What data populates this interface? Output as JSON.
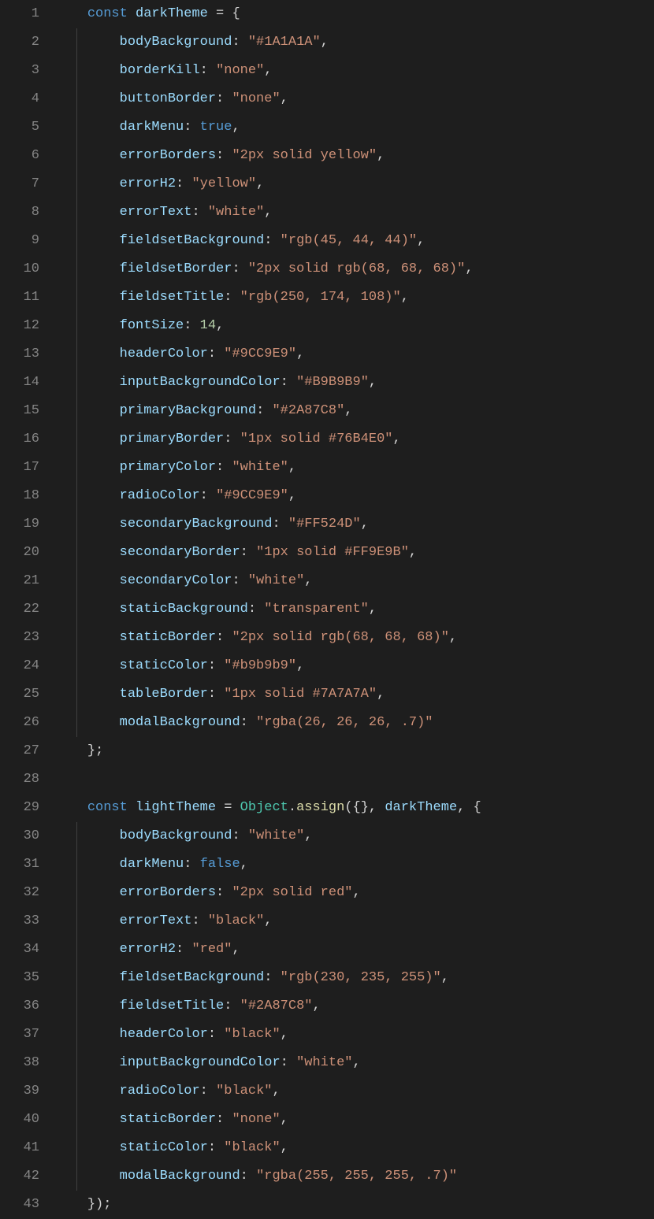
{
  "lines": [
    {
      "n": 1,
      "indent": 1,
      "guides": 0,
      "tokens": [
        [
          "kw",
          "const"
        ],
        [
          "pun",
          " "
        ],
        [
          "var",
          "darkTheme"
        ],
        [
          "pun",
          " = {"
        ]
      ]
    },
    {
      "n": 2,
      "indent": 2,
      "guides": 1,
      "tokens": [
        [
          "prop",
          "bodyBackground"
        ],
        [
          "pun",
          ": "
        ],
        [
          "str",
          "\"#1A1A1A\""
        ],
        [
          "pun",
          ","
        ]
      ]
    },
    {
      "n": 3,
      "indent": 2,
      "guides": 1,
      "tokens": [
        [
          "prop",
          "borderKill"
        ],
        [
          "pun",
          ": "
        ],
        [
          "str",
          "\"none\""
        ],
        [
          "pun",
          ","
        ]
      ]
    },
    {
      "n": 4,
      "indent": 2,
      "guides": 1,
      "tokens": [
        [
          "prop",
          "buttonBorder"
        ],
        [
          "pun",
          ": "
        ],
        [
          "str",
          "\"none\""
        ],
        [
          "pun",
          ","
        ]
      ]
    },
    {
      "n": 5,
      "indent": 2,
      "guides": 1,
      "tokens": [
        [
          "prop",
          "darkMenu"
        ],
        [
          "pun",
          ": "
        ],
        [
          "bool",
          "true"
        ],
        [
          "pun",
          ","
        ]
      ]
    },
    {
      "n": 6,
      "indent": 2,
      "guides": 1,
      "tokens": [
        [
          "prop",
          "errorBorders"
        ],
        [
          "pun",
          ": "
        ],
        [
          "str",
          "\"2px solid yellow\""
        ],
        [
          "pun",
          ","
        ]
      ]
    },
    {
      "n": 7,
      "indent": 2,
      "guides": 1,
      "tokens": [
        [
          "prop",
          "errorH2"
        ],
        [
          "pun",
          ": "
        ],
        [
          "str",
          "\"yellow\""
        ],
        [
          "pun",
          ","
        ]
      ]
    },
    {
      "n": 8,
      "indent": 2,
      "guides": 1,
      "tokens": [
        [
          "prop",
          "errorText"
        ],
        [
          "pun",
          ": "
        ],
        [
          "str",
          "\"white\""
        ],
        [
          "pun",
          ","
        ]
      ]
    },
    {
      "n": 9,
      "indent": 2,
      "guides": 1,
      "tokens": [
        [
          "prop",
          "fieldsetBackground"
        ],
        [
          "pun",
          ": "
        ],
        [
          "str",
          "\"rgb(45, 44, 44)\""
        ],
        [
          "pun",
          ","
        ]
      ]
    },
    {
      "n": 10,
      "indent": 2,
      "guides": 1,
      "tokens": [
        [
          "prop",
          "fieldsetBorder"
        ],
        [
          "pun",
          ": "
        ],
        [
          "str",
          "\"2px solid rgb(68, 68, 68)\""
        ],
        [
          "pun",
          ","
        ]
      ]
    },
    {
      "n": 11,
      "indent": 2,
      "guides": 1,
      "tokens": [
        [
          "prop",
          "fieldsetTitle"
        ],
        [
          "pun",
          ": "
        ],
        [
          "str",
          "\"rgb(250, 174, 108)\""
        ],
        [
          "pun",
          ","
        ]
      ]
    },
    {
      "n": 12,
      "indent": 2,
      "guides": 1,
      "tokens": [
        [
          "prop",
          "fontSize"
        ],
        [
          "pun",
          ": "
        ],
        [
          "num",
          "14"
        ],
        [
          "pun",
          ","
        ]
      ]
    },
    {
      "n": 13,
      "indent": 2,
      "guides": 1,
      "tokens": [
        [
          "prop",
          "headerColor"
        ],
        [
          "pun",
          ": "
        ],
        [
          "str",
          "\"#9CC9E9\""
        ],
        [
          "pun",
          ","
        ]
      ]
    },
    {
      "n": 14,
      "indent": 2,
      "guides": 1,
      "tokens": [
        [
          "prop",
          "inputBackgroundColor"
        ],
        [
          "pun",
          ": "
        ],
        [
          "str",
          "\"#B9B9B9\""
        ],
        [
          "pun",
          ","
        ]
      ]
    },
    {
      "n": 15,
      "indent": 2,
      "guides": 1,
      "tokens": [
        [
          "prop",
          "primaryBackground"
        ],
        [
          "pun",
          ": "
        ],
        [
          "str",
          "\"#2A87C8\""
        ],
        [
          "pun",
          ","
        ]
      ]
    },
    {
      "n": 16,
      "indent": 2,
      "guides": 1,
      "tokens": [
        [
          "prop",
          "primaryBorder"
        ],
        [
          "pun",
          ": "
        ],
        [
          "str",
          "\"1px solid #76B4E0\""
        ],
        [
          "pun",
          ","
        ]
      ]
    },
    {
      "n": 17,
      "indent": 2,
      "guides": 1,
      "tokens": [
        [
          "prop",
          "primaryColor"
        ],
        [
          "pun",
          ": "
        ],
        [
          "str",
          "\"white\""
        ],
        [
          "pun",
          ","
        ]
      ]
    },
    {
      "n": 18,
      "indent": 2,
      "guides": 1,
      "tokens": [
        [
          "prop",
          "radioColor"
        ],
        [
          "pun",
          ": "
        ],
        [
          "str",
          "\"#9CC9E9\""
        ],
        [
          "pun",
          ","
        ]
      ]
    },
    {
      "n": 19,
      "indent": 2,
      "guides": 1,
      "tokens": [
        [
          "prop",
          "secondaryBackground"
        ],
        [
          "pun",
          ": "
        ],
        [
          "str",
          "\"#FF524D\""
        ],
        [
          "pun",
          ","
        ]
      ]
    },
    {
      "n": 20,
      "indent": 2,
      "guides": 1,
      "tokens": [
        [
          "prop",
          "secondaryBorder"
        ],
        [
          "pun",
          ": "
        ],
        [
          "str",
          "\"1px solid #FF9E9B\""
        ],
        [
          "pun",
          ","
        ]
      ]
    },
    {
      "n": 21,
      "indent": 2,
      "guides": 1,
      "tokens": [
        [
          "prop",
          "secondaryColor"
        ],
        [
          "pun",
          ": "
        ],
        [
          "str",
          "\"white\""
        ],
        [
          "pun",
          ","
        ]
      ]
    },
    {
      "n": 22,
      "indent": 2,
      "guides": 1,
      "tokens": [
        [
          "prop",
          "staticBackground"
        ],
        [
          "pun",
          ": "
        ],
        [
          "str",
          "\"transparent\""
        ],
        [
          "pun",
          ","
        ]
      ]
    },
    {
      "n": 23,
      "indent": 2,
      "guides": 1,
      "tokens": [
        [
          "prop",
          "staticBorder"
        ],
        [
          "pun",
          ": "
        ],
        [
          "str",
          "\"2px solid rgb(68, 68, 68)\""
        ],
        [
          "pun",
          ","
        ]
      ]
    },
    {
      "n": 24,
      "indent": 2,
      "guides": 1,
      "tokens": [
        [
          "prop",
          "staticColor"
        ],
        [
          "pun",
          ": "
        ],
        [
          "str",
          "\"#b9b9b9\""
        ],
        [
          "pun",
          ","
        ]
      ]
    },
    {
      "n": 25,
      "indent": 2,
      "guides": 1,
      "tokens": [
        [
          "prop",
          "tableBorder"
        ],
        [
          "pun",
          ": "
        ],
        [
          "str",
          "\"1px solid #7A7A7A\""
        ],
        [
          "pun",
          ","
        ]
      ]
    },
    {
      "n": 26,
      "indent": 2,
      "guides": 1,
      "tokens": [
        [
          "prop",
          "modalBackground"
        ],
        [
          "pun",
          ": "
        ],
        [
          "str",
          "\"rgba(26, 26, 26, .7)\""
        ]
      ]
    },
    {
      "n": 27,
      "indent": 1,
      "guides": 0,
      "tokens": [
        [
          "pun",
          "};"
        ]
      ]
    },
    {
      "n": 28,
      "indent": 0,
      "guides": 0,
      "tokens": []
    },
    {
      "n": 29,
      "indent": 1,
      "guides": 0,
      "tokens": [
        [
          "kw",
          "const"
        ],
        [
          "pun",
          " "
        ],
        [
          "var",
          "lightTheme"
        ],
        [
          "pun",
          " = "
        ],
        [
          "cls",
          "Object"
        ],
        [
          "pun",
          "."
        ],
        [
          "fn",
          "assign"
        ],
        [
          "pun",
          "({}, "
        ],
        [
          "var",
          "darkTheme"
        ],
        [
          "pun",
          ", {"
        ]
      ]
    },
    {
      "n": 30,
      "indent": 2,
      "guides": 1,
      "tokens": [
        [
          "prop",
          "bodyBackground"
        ],
        [
          "pun",
          ": "
        ],
        [
          "str",
          "\"white\""
        ],
        [
          "pun",
          ","
        ]
      ]
    },
    {
      "n": 31,
      "indent": 2,
      "guides": 1,
      "tokens": [
        [
          "prop",
          "darkMenu"
        ],
        [
          "pun",
          ": "
        ],
        [
          "bool",
          "false"
        ],
        [
          "pun",
          ","
        ]
      ]
    },
    {
      "n": 32,
      "indent": 2,
      "guides": 1,
      "tokens": [
        [
          "prop",
          "errorBorders"
        ],
        [
          "pun",
          ": "
        ],
        [
          "str",
          "\"2px solid red\""
        ],
        [
          "pun",
          ","
        ]
      ]
    },
    {
      "n": 33,
      "indent": 2,
      "guides": 1,
      "tokens": [
        [
          "prop",
          "errorText"
        ],
        [
          "pun",
          ": "
        ],
        [
          "str",
          "\"black\""
        ],
        [
          "pun",
          ","
        ]
      ]
    },
    {
      "n": 34,
      "indent": 2,
      "guides": 1,
      "tokens": [
        [
          "prop",
          "errorH2"
        ],
        [
          "pun",
          ": "
        ],
        [
          "str",
          "\"red\""
        ],
        [
          "pun",
          ","
        ]
      ]
    },
    {
      "n": 35,
      "indent": 2,
      "guides": 1,
      "tokens": [
        [
          "prop",
          "fieldsetBackground"
        ],
        [
          "pun",
          ": "
        ],
        [
          "str",
          "\"rgb(230, 235, 255)\""
        ],
        [
          "pun",
          ","
        ]
      ]
    },
    {
      "n": 36,
      "indent": 2,
      "guides": 1,
      "tokens": [
        [
          "prop",
          "fieldsetTitle"
        ],
        [
          "pun",
          ": "
        ],
        [
          "str",
          "\"#2A87C8\""
        ],
        [
          "pun",
          ","
        ]
      ]
    },
    {
      "n": 37,
      "indent": 2,
      "guides": 1,
      "tokens": [
        [
          "prop",
          "headerColor"
        ],
        [
          "pun",
          ": "
        ],
        [
          "str",
          "\"black\""
        ],
        [
          "pun",
          ","
        ]
      ]
    },
    {
      "n": 38,
      "indent": 2,
      "guides": 1,
      "tokens": [
        [
          "prop",
          "inputBackgroundColor"
        ],
        [
          "pun",
          ": "
        ],
        [
          "str",
          "\"white\""
        ],
        [
          "pun",
          ","
        ]
      ]
    },
    {
      "n": 39,
      "indent": 2,
      "guides": 1,
      "tokens": [
        [
          "prop",
          "radioColor"
        ],
        [
          "pun",
          ": "
        ],
        [
          "str",
          "\"black\""
        ],
        [
          "pun",
          ","
        ]
      ]
    },
    {
      "n": 40,
      "indent": 2,
      "guides": 1,
      "tokens": [
        [
          "prop",
          "staticBorder"
        ],
        [
          "pun",
          ": "
        ],
        [
          "str",
          "\"none\""
        ],
        [
          "pun",
          ","
        ]
      ]
    },
    {
      "n": 41,
      "indent": 2,
      "guides": 1,
      "tokens": [
        [
          "prop",
          "staticColor"
        ],
        [
          "pun",
          ": "
        ],
        [
          "str",
          "\"black\""
        ],
        [
          "pun",
          ","
        ]
      ]
    },
    {
      "n": 42,
      "indent": 2,
      "guides": 1,
      "tokens": [
        [
          "prop",
          "modalBackground"
        ],
        [
          "pun",
          ": "
        ],
        [
          "str",
          "\"rgba(255, 255, 255, .7)\""
        ]
      ]
    },
    {
      "n": 43,
      "indent": 1,
      "guides": 0,
      "tokens": [
        [
          "pun",
          "});"
        ]
      ]
    }
  ],
  "indentUnit": "    ",
  "indentGuideOffsets": [
    27,
    68
  ]
}
